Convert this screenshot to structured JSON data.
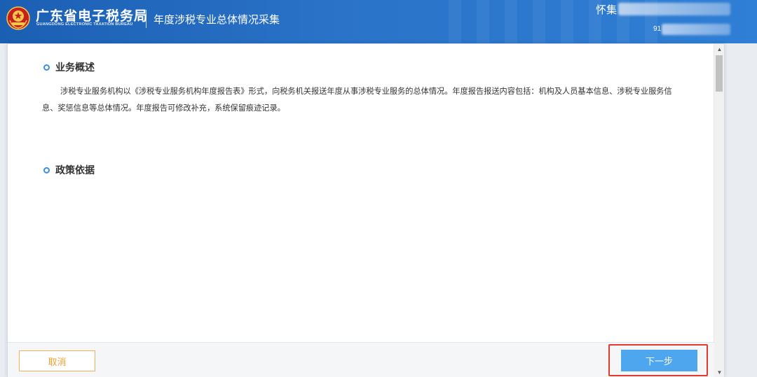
{
  "header": {
    "brand_cn": "广东省电子税务局",
    "brand_en": "GUANGDONG ELECTRONIC TAXATION BUREAU",
    "module_title": "年度涉税专业总体情况采集",
    "user_name": "怀集",
    "user_id": "91"
  },
  "sections": [
    {
      "title": "业务概述",
      "text": "涉税专业服务机构以《涉税专业服务机构年度报告表》形式，向税务机关报送年度从事涉税专业服务的总体情况。年度报告报送内容包括：机构及人员基本信息、涉税专业服务信息、奖惩信息等总体情况。年度报告可修改补充，系统保留痕迹记录。"
    },
    {
      "title": "政策依据"
    }
  ],
  "footer": {
    "cancel_label": "取消",
    "next_label": "下一步"
  },
  "colors": {
    "header_blue": "#2a73c8",
    "accent_blue": "#4ea6ee",
    "cancel_orange": "#f0a030",
    "highlight_red": "#e33b2e"
  },
  "icons": {
    "emblem": "tax-emblem-icon",
    "scroll_up": "arrow-up-icon",
    "scroll_down": "arrow-down-icon"
  }
}
